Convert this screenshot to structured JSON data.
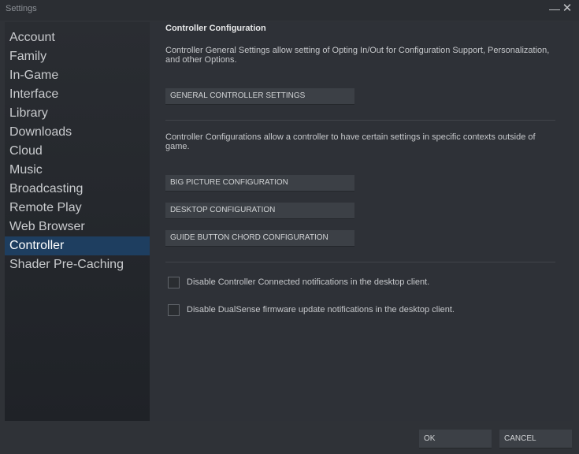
{
  "window": {
    "title": "Settings",
    "minimize_glyph": "—",
    "close_glyph": "✕"
  },
  "sidebar": {
    "items": [
      {
        "label": "Account"
      },
      {
        "label": "Family"
      },
      {
        "label": "In-Game"
      },
      {
        "label": "Interface"
      },
      {
        "label": "Library"
      },
      {
        "label": "Downloads"
      },
      {
        "label": "Cloud"
      },
      {
        "label": "Music"
      },
      {
        "label": "Broadcasting"
      },
      {
        "label": "Remote Play"
      },
      {
        "label": "Web Browser"
      },
      {
        "label": "Controller"
      },
      {
        "label": "Shader Pre-Caching"
      }
    ],
    "selected": "Controller"
  },
  "content": {
    "heading": "Controller Configuration",
    "general_desc": "Controller General Settings allow setting of Opting In/Out for Configuration Support, Personalization, and other Options.",
    "general_button": "GENERAL CONTROLLER SETTINGS",
    "configs_desc": "Controller Configurations allow a controller to have certain settings in specific contexts outside of game.",
    "buttons": {
      "big_picture": "BIG PICTURE CONFIGURATION",
      "desktop": "DESKTOP CONFIGURATION",
      "guide_chord": "GUIDE BUTTON CHORD CONFIGURATION"
    },
    "checkboxes": [
      {
        "label": "Disable Controller Connected notifications in the desktop client.",
        "checked": false
      },
      {
        "label": "Disable DualSense firmware update notifications in the desktop client.",
        "checked": false
      }
    ]
  },
  "footer": {
    "ok": "OK",
    "cancel": "CANCEL"
  },
  "colors": {
    "background": "#2f3237",
    "selected_item": "#1e3e60",
    "button": "#3c4046"
  }
}
